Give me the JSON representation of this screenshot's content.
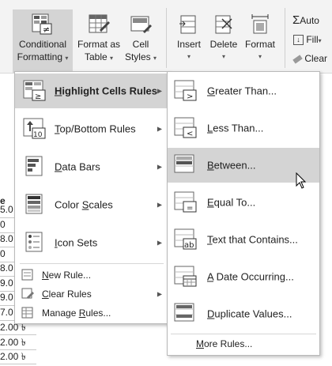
{
  "ribbon": {
    "conditional_formatting": {
      "line1": "Conditional",
      "line2": "Formatting",
      "caret": "▾"
    },
    "format_as_table": {
      "line1": "Format as",
      "line2": "Table",
      "caret": "▾"
    },
    "cell_styles": {
      "line1": "Cell",
      "line2": "Styles",
      "caret": "▾"
    },
    "insert": {
      "label": "Insert",
      "caret": "▾"
    },
    "delete": {
      "label": "Delete",
      "caret": "▾"
    },
    "format": {
      "label": "Format",
      "caret": "▾"
    },
    "autosum": {
      "symbol": "Σ",
      "label": "Auto"
    },
    "fill": {
      "label": "Fill",
      "caret": "▾"
    },
    "clear": {
      "label": "Clear"
    }
  },
  "sheet": {
    "col_partial": "e",
    "cells": [
      "5.0",
      "0",
      "8.0",
      "0",
      "8.0",
      "9.0",
      "9.0",
      "7.0",
      "2.00 ৳",
      "2.00 ৳",
      "2.00 ৳"
    ]
  },
  "main_menu": {
    "items": [
      {
        "pre": "",
        "u": "H",
        "post": "ighlight Cells Rules",
        "bold": true
      },
      {
        "pre": "",
        "u": "T",
        "post": "op/Bottom Rules",
        "bold": false
      },
      {
        "pre": "",
        "u": "D",
        "post": "ata Bars",
        "bold": false
      },
      {
        "pre": "Color ",
        "u": "S",
        "post": "cales",
        "bold": false
      },
      {
        "pre": "",
        "u": "I",
        "post": "con Sets",
        "bold": false
      }
    ],
    "small_items": [
      {
        "pre": "",
        "u": "N",
        "post": "ew Rule..."
      },
      {
        "pre": "",
        "u": "C",
        "post": "lear Rules"
      },
      {
        "pre": "Manage ",
        "u": "R",
        "post": "ules..."
      }
    ],
    "arrow": "▶"
  },
  "submenu": {
    "items": [
      {
        "pre": "",
        "u": "G",
        "post": "reater Than..."
      },
      {
        "pre": "",
        "u": "L",
        "post": "ess Than..."
      },
      {
        "pre": "",
        "u": "B",
        "post": "etween..."
      },
      {
        "pre": "",
        "u": "E",
        "post": "qual To..."
      },
      {
        "pre": "",
        "u": "T",
        "post": "ext that Contains..."
      },
      {
        "pre": "",
        "u": "A",
        "post": " Date Occurring..."
      },
      {
        "pre": "",
        "u": "D",
        "post": "uplicate Values..."
      }
    ],
    "more": {
      "pre": "",
      "u": "M",
      "post": "ore Rules..."
    }
  },
  "colors": {
    "highlight": "#d4d4d4",
    "menu_border": "#b9b9b9"
  }
}
